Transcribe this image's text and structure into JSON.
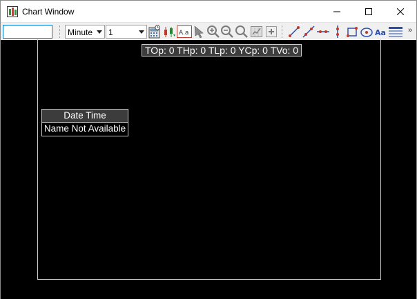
{
  "window": {
    "title": "Chart Window"
  },
  "toolbar": {
    "symbol_value": "",
    "timeframe": {
      "selected": "Minute"
    },
    "interval": {
      "selected": "1"
    },
    "overflow": "»"
  },
  "chart": {
    "info_line": "TOp: 0 THp: 0 TLp: 0 YCp: 0 TVo: 0",
    "legend_header": "Date Time",
    "legend_name": "Name Not Available",
    "background": "#000000",
    "frame_color": "#cfcfcf"
  },
  "icons": {
    "app": "candlestick-app-icon",
    "tools": [
      "calculator-icon",
      "candle-up-down-icon",
      "text-font-icon",
      "pointer-arrow-icon",
      "zoom-in-icon",
      "zoom-out-icon",
      "zoom-fit-icon",
      "chart-grid-icon",
      "add-icon",
      "trend-line-icon",
      "ray-line-icon",
      "horizontal-line-icon",
      "vertical-line-icon",
      "rectangle-icon",
      "ellipse-icon",
      "text-annotation-icon",
      "chart-properties-icon"
    ]
  }
}
